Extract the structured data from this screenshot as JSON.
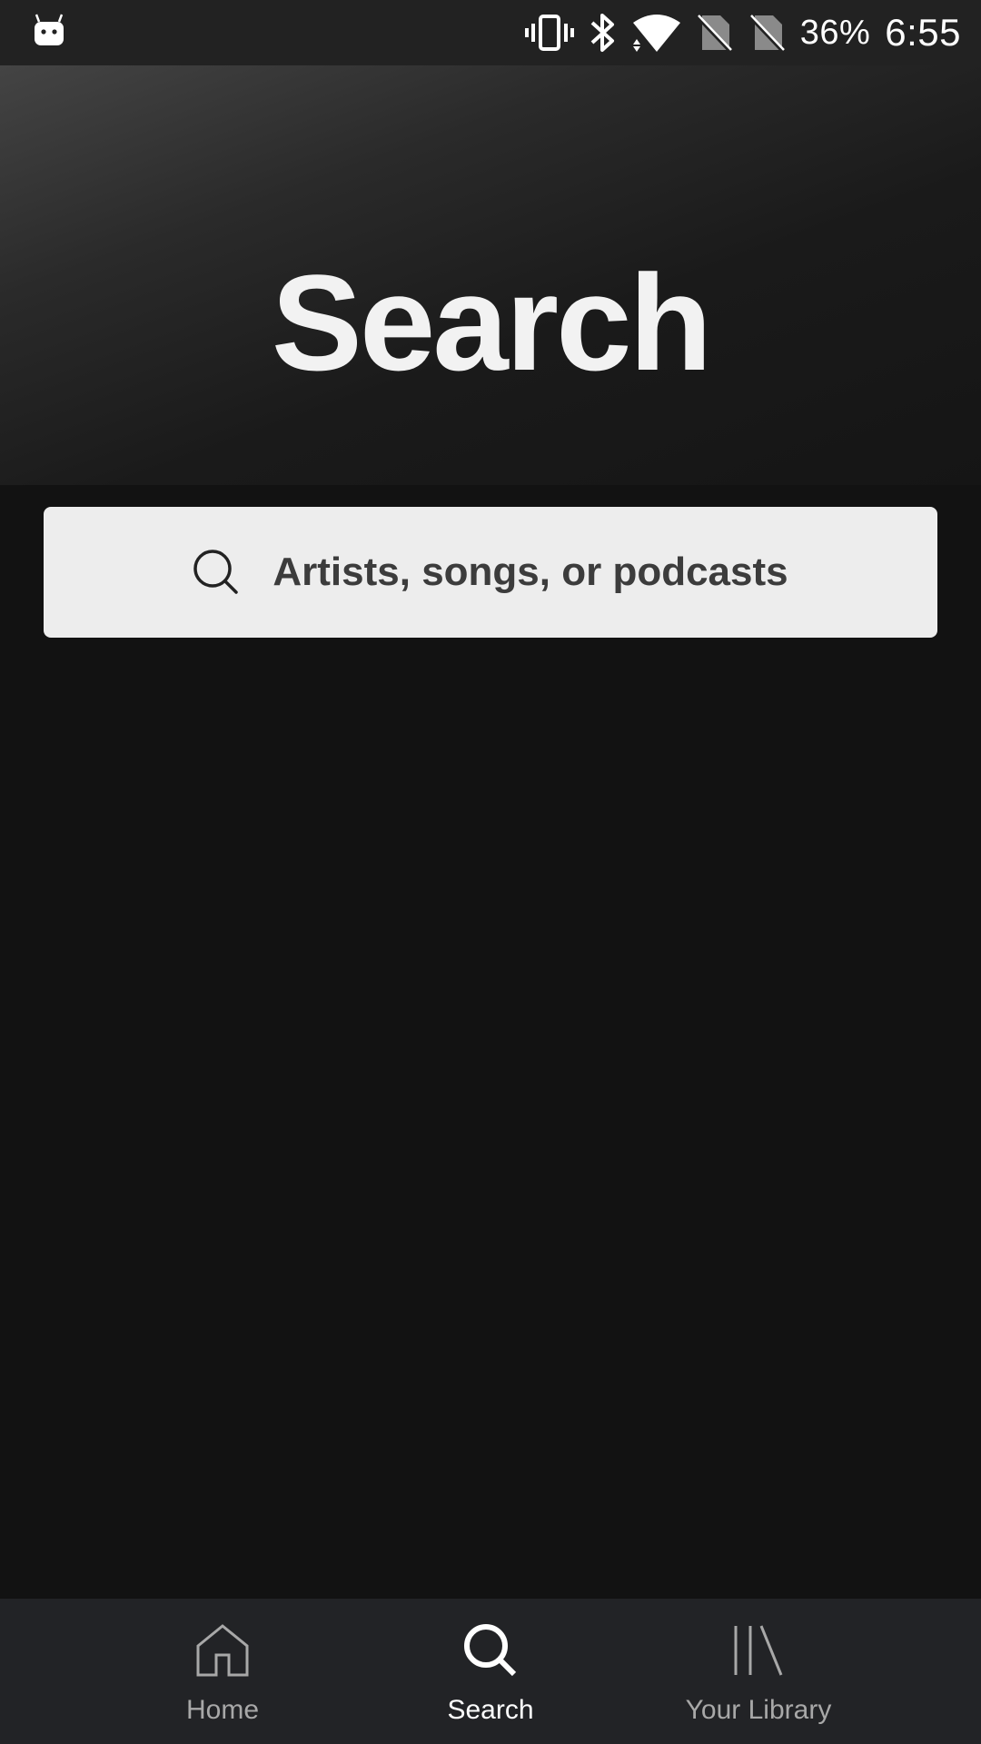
{
  "status_bar": {
    "battery": "36%",
    "time": "6:55",
    "icons": [
      "android-notification-icon",
      "vibrate-icon",
      "bluetooth-icon",
      "wifi-icon",
      "no-sim-icon",
      "no-sim-icon"
    ]
  },
  "header": {
    "title": "Search"
  },
  "search": {
    "placeholder": "Artists, songs, or podcasts"
  },
  "bottom_nav": {
    "items": [
      {
        "label": "Home",
        "icon": "home-icon",
        "active": false
      },
      {
        "label": "Search",
        "icon": "search-icon",
        "active": true
      },
      {
        "label": "Your Library",
        "icon": "library-icon",
        "active": false
      }
    ]
  },
  "colors": {
    "background": "#121212",
    "status_bar": "#222222",
    "search_box": "#ededed",
    "nav_background": "#222326",
    "nav_inactive": "#a8a8a8",
    "nav_active": "#ffffff"
  }
}
